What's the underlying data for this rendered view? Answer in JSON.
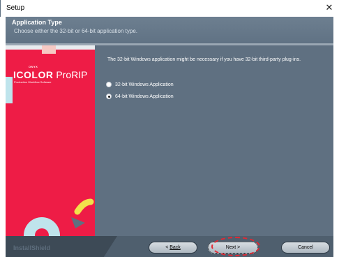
{
  "window": {
    "title": "Setup",
    "close_glyph": "✕"
  },
  "header": {
    "title": "Application Type",
    "subtitle": "Choose either the 32-bit or 64-bit application type."
  },
  "banner": {
    "brand_top": "ONYX",
    "brand_icolor": "ICOLOR",
    "brand_prorip": "ProRIP",
    "brand_sub": "Production Workflow Software"
  },
  "main": {
    "message": "The 32-bit Windows application might be necessary if you have 32-bit third-party plug-ins.",
    "options": [
      {
        "label": "32-bit Windows Application",
        "checked": false
      },
      {
        "label": "64-bit Windows Application",
        "checked": true
      }
    ]
  },
  "footer": {
    "installshield": "InstallShield",
    "back_label": "Back",
    "next_label": "Next >",
    "cancel_label": "Cancel"
  },
  "colors": {
    "banner": "#ee1c46",
    "content": "#5f7081",
    "header": "#6d7f90",
    "highlight": "#e32833"
  },
  "icons": {
    "close": "close-icon",
    "radio_unchecked": "radio-unchecked-icon",
    "radio_checked": "radio-checked-icon"
  }
}
